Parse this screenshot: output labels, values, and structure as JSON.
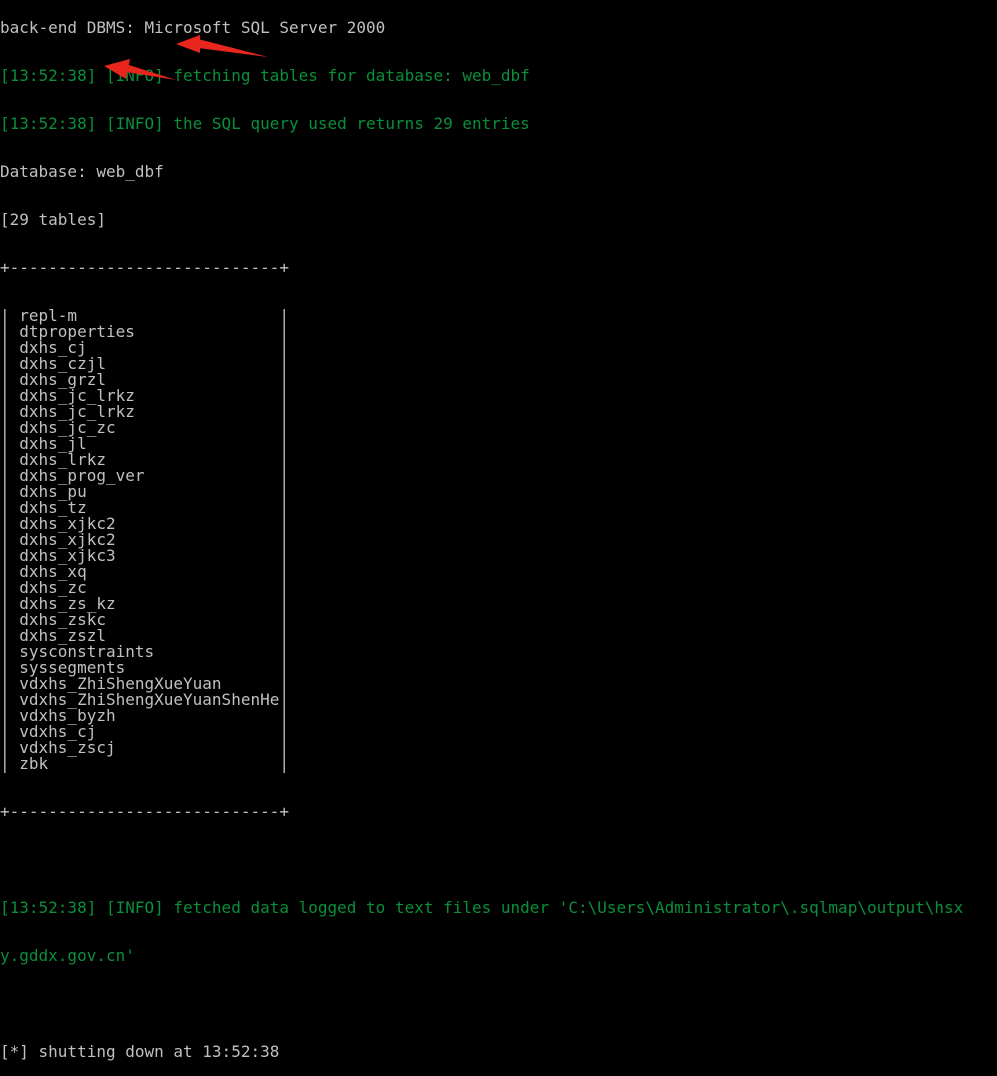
{
  "terminal": {
    "header_partial": "back-end DBMS: Microsoft SQL Server 2000",
    "info_lines": [
      "[13:52:38] [INFO] fetching tables for database: web_dbf",
      "[13:52:38] [INFO] the SQL query used returns 29 entries"
    ],
    "database_line": "Database: web_dbf",
    "tables_count_line": "[29 tables]",
    "table_border": "+----------------------------+",
    "table_left_bar": "| ",
    "table_right_bar": "|",
    "tables": [
      "repl-m",
      "dtproperties",
      "dxhs_cj",
      "dxhs_czjl",
      "dxhs_grzl",
      "dxhs_jc_lrkz",
      "dxhs_jc_lrkz",
      "dxhs_jc_zc",
      "dxhs_jl",
      "dxhs_lrkz",
      "dxhs_prog_ver",
      "dxhs_pu",
      "dxhs_tz",
      "dxhs_xjkc2",
      "dxhs_xjkc2",
      "dxhs_xjkc3",
      "dxhs_xq",
      "dxhs_zc",
      "dxhs_zs_kz",
      "dxhs_zskc",
      "dxhs_zszl",
      "sysconstraints",
      "syssegments",
      "vdxhs_ZhiShengXueYuan",
      "vdxhs_ZhiShengXueYuanShenHe",
      "vdxhs_byzh",
      "vdxhs_cj",
      "vdxhs_zscj",
      "zbk"
    ],
    "fetched_line_1": "[13:52:38] [INFO] fetched data logged to text files under 'C:\\Users\\Administrator\\.sqlmap\\output\\hsx",
    "fetched_line_2": "y.gddx.gov.cn'",
    "shutdown_line": "[*] shutting down at 13:52:38"
  },
  "colors": {
    "background": "#000000",
    "text": "#c0c0c0",
    "info_green": "#0a8f3a",
    "arrow_red": "#e8261e"
  }
}
